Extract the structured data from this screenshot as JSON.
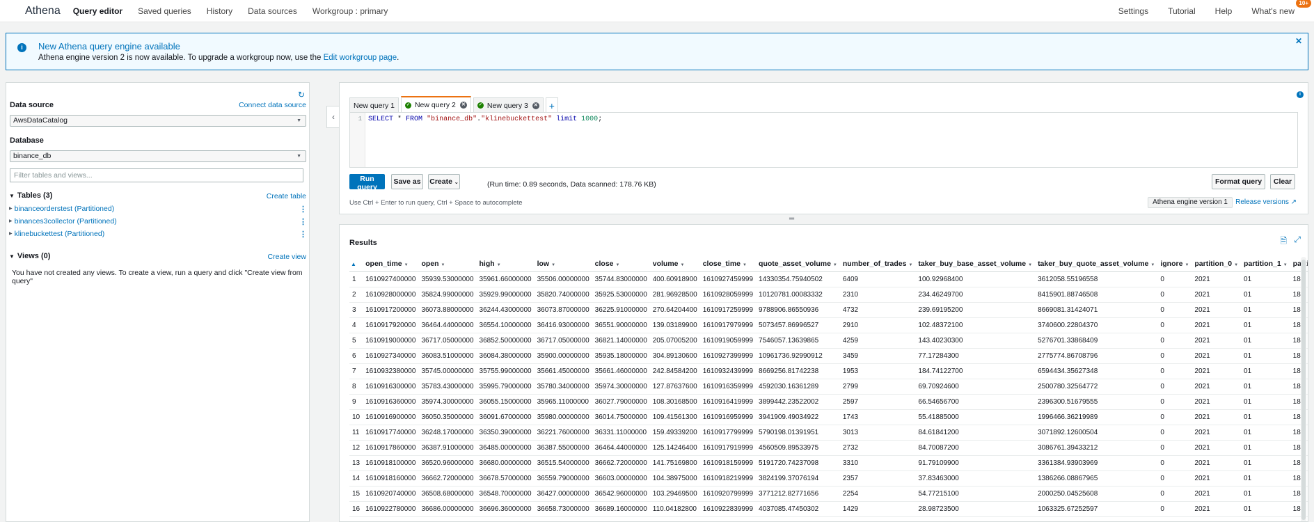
{
  "topnav": {
    "brand": "Athena",
    "items": [
      "Query editor",
      "Saved queries",
      "History",
      "Data sources",
      "Workgroup : primary"
    ],
    "right_items": [
      "Settings",
      "Tutorial",
      "Help",
      "What's new"
    ],
    "badge": "10+"
  },
  "banner": {
    "title": "New Athena query engine available",
    "message": "Athena engine version 2 is now available. To upgrade a workgroup now, use the",
    "link": "Edit workgroup page",
    "message_end": ".",
    "close": "✕"
  },
  "left": {
    "data_source_label": "Data source",
    "connect_link": "Connect data source",
    "data_source_value": "AwsDataCatalog",
    "database_label": "Database",
    "database_value": "binance_db",
    "filter_placeholder": "Filter tables and views...",
    "tables_header": "Tables (3)",
    "create_table": "Create table",
    "tables": [
      "binanceorderstest (Partitioned)",
      "binances3collector (Partitioned)",
      "klinebuckettest (Partitioned)"
    ],
    "views_header": "Views (0)",
    "create_view": "Create view",
    "views_empty": "You have not created any views. To create a view, run a query and click \"Create view from query\""
  },
  "editor": {
    "tabs": [
      {
        "label": "New query 1",
        "status": "none"
      },
      {
        "label": "New query 2",
        "status": "success"
      },
      {
        "label": "New query 3",
        "status": "success"
      }
    ],
    "line_number": "1",
    "code": {
      "select": "SELECT",
      "star": " * ",
      "from": "FROM",
      "db": "\"binance_db\"",
      "dot": ".",
      "table": "\"klinebuckettest\"",
      "limit": "limit",
      "n": "1000",
      "end": ";"
    },
    "run_button": "Run query",
    "save_button": "Save as",
    "create_button": "Create",
    "run_stats": "(Run time: 0.89 seconds, Data scanned: 178.76 KB)",
    "format_button": "Format query",
    "clear_button": "Clear",
    "hint": "Use Ctrl + Enter to run query, Ctrl + Space to autocomplete",
    "engine_badge": "Athena engine version 1",
    "release_link": "Release versions"
  },
  "results": {
    "title": "Results",
    "columns": [
      "open_time",
      "open",
      "high",
      "low",
      "close",
      "volume",
      "close_time",
      "quote_asset_volume",
      "number_of_trades",
      "taker_buy_base_asset_volume",
      "taker_buy_quote_asset_volume",
      "ignore",
      "partition_0",
      "partition_1",
      "partition_"
    ],
    "rows": [
      [
        "1",
        "1610927400000",
        "35939.53000000",
        "35961.66000000",
        "35506.00000000",
        "35744.83000000",
        "400.60918900",
        "1610927459999",
        "14330354.75940502",
        "6409",
        "100.92968400",
        "3612058.55196558",
        "0",
        "2021",
        "01",
        "18"
      ],
      [
        "2",
        "1610928000000",
        "35824.99000000",
        "35929.99000000",
        "35820.74000000",
        "35925.53000000",
        "281.96928500",
        "1610928059999",
        "10120781.00083332",
        "2310",
        "234.46249700",
        "8415901.88746508",
        "0",
        "2021",
        "01",
        "18"
      ],
      [
        "3",
        "1610917200000",
        "36073.88000000",
        "36244.43000000",
        "36073.87000000",
        "36225.91000000",
        "270.64204400",
        "1610917259999",
        "9788906.86550936",
        "4732",
        "239.69195200",
        "8669081.31424071",
        "0",
        "2021",
        "01",
        "18"
      ],
      [
        "4",
        "1610917920000",
        "36464.44000000",
        "36554.10000000",
        "36416.93000000",
        "36551.90000000",
        "139.03189900",
        "1610917979999",
        "5073457.86996527",
        "2910",
        "102.48372100",
        "3740600.22804370",
        "0",
        "2021",
        "01",
        "18"
      ],
      [
        "5",
        "1610919000000",
        "36717.05000000",
        "36852.50000000",
        "36717.05000000",
        "36821.14000000",
        "205.07005200",
        "1610919059999",
        "7546057.13639865",
        "4259",
        "143.40230300",
        "5276701.33868409",
        "0",
        "2021",
        "01",
        "18"
      ],
      [
        "6",
        "1610927340000",
        "36083.51000000",
        "36084.38000000",
        "35900.00000000",
        "35935.18000000",
        "304.89130600",
        "1610927399999",
        "10961736.92990912",
        "3459",
        "77.17284300",
        "2775774.86708796",
        "0",
        "2021",
        "01",
        "18"
      ],
      [
        "7",
        "1610932380000",
        "35745.00000000",
        "35755.99000000",
        "35661.45000000",
        "35661.46000000",
        "242.84584200",
        "1610932439999",
        "8669256.81742238",
        "1953",
        "184.74122700",
        "6594434.35627348",
        "0",
        "2021",
        "01",
        "18"
      ],
      [
        "8",
        "1610916300000",
        "35783.43000000",
        "35995.79000000",
        "35780.34000000",
        "35974.30000000",
        "127.87637600",
        "1610916359999",
        "4592030.16361289",
        "2799",
        "69.70924600",
        "2500780.32564772",
        "0",
        "2021",
        "01",
        "18"
      ],
      [
        "9",
        "1610916360000",
        "35974.30000000",
        "36055.15000000",
        "35965.11000000",
        "36027.79000000",
        "108.30168500",
        "1610916419999",
        "3899442.23522002",
        "2597",
        "66.54656700",
        "2396300.51679555",
        "0",
        "2021",
        "01",
        "18"
      ],
      [
        "10",
        "1610916900000",
        "36050.35000000",
        "36091.67000000",
        "35980.00000000",
        "36014.75000000",
        "109.41561300",
        "1610916959999",
        "3941909.49034922",
        "1743",
        "55.41885000",
        "1996466.36219989",
        "0",
        "2021",
        "01",
        "18"
      ],
      [
        "11",
        "1610917740000",
        "36248.17000000",
        "36350.39000000",
        "36221.76000000",
        "36331.11000000",
        "159.49339200",
        "1610917799999",
        "5790198.01391951",
        "3013",
        "84.61841200",
        "3071892.12600504",
        "0",
        "2021",
        "01",
        "18"
      ],
      [
        "12",
        "1610917860000",
        "36387.91000000",
        "36485.00000000",
        "36387.55000000",
        "36464.44000000",
        "125.14246400",
        "1610917919999",
        "4560509.89533975",
        "2732",
        "84.70087200",
        "3086761.39433212",
        "0",
        "2021",
        "01",
        "18"
      ],
      [
        "13",
        "1610918100000",
        "36520.96000000",
        "36680.00000000",
        "36515.54000000",
        "36662.72000000",
        "141.75169800",
        "1610918159999",
        "5191720.74237098",
        "3310",
        "91.79109900",
        "3361384.93903969",
        "0",
        "2021",
        "01",
        "18"
      ],
      [
        "14",
        "1610918160000",
        "36662.72000000",
        "36678.57000000",
        "36559.79000000",
        "36603.00000000",
        "104.38975000",
        "1610918219999",
        "3824199.37076194",
        "2357",
        "37.83463000",
        "1386266.08867965",
        "0",
        "2021",
        "01",
        "18"
      ],
      [
        "15",
        "1610920740000",
        "36508.68000000",
        "36548.70000000",
        "36427.00000000",
        "36542.96000000",
        "103.29469500",
        "1610920799999",
        "3771212.82771656",
        "2254",
        "54.77215100",
        "2000250.04525608",
        "0",
        "2021",
        "01",
        "18"
      ],
      [
        "16",
        "1610922780000",
        "36686.00000000",
        "36696.36000000",
        "36658.73000000",
        "36689.16000000",
        "110.04182800",
        "1610922839999",
        "4037085.47450302",
        "1429",
        "28.98723500",
        "1063325.67252597",
        "0",
        "2021",
        "01",
        "18"
      ]
    ]
  },
  "colors": {
    "accent": "#0073bb",
    "tab_active": "#ec7211",
    "success": "#1d8102"
  }
}
